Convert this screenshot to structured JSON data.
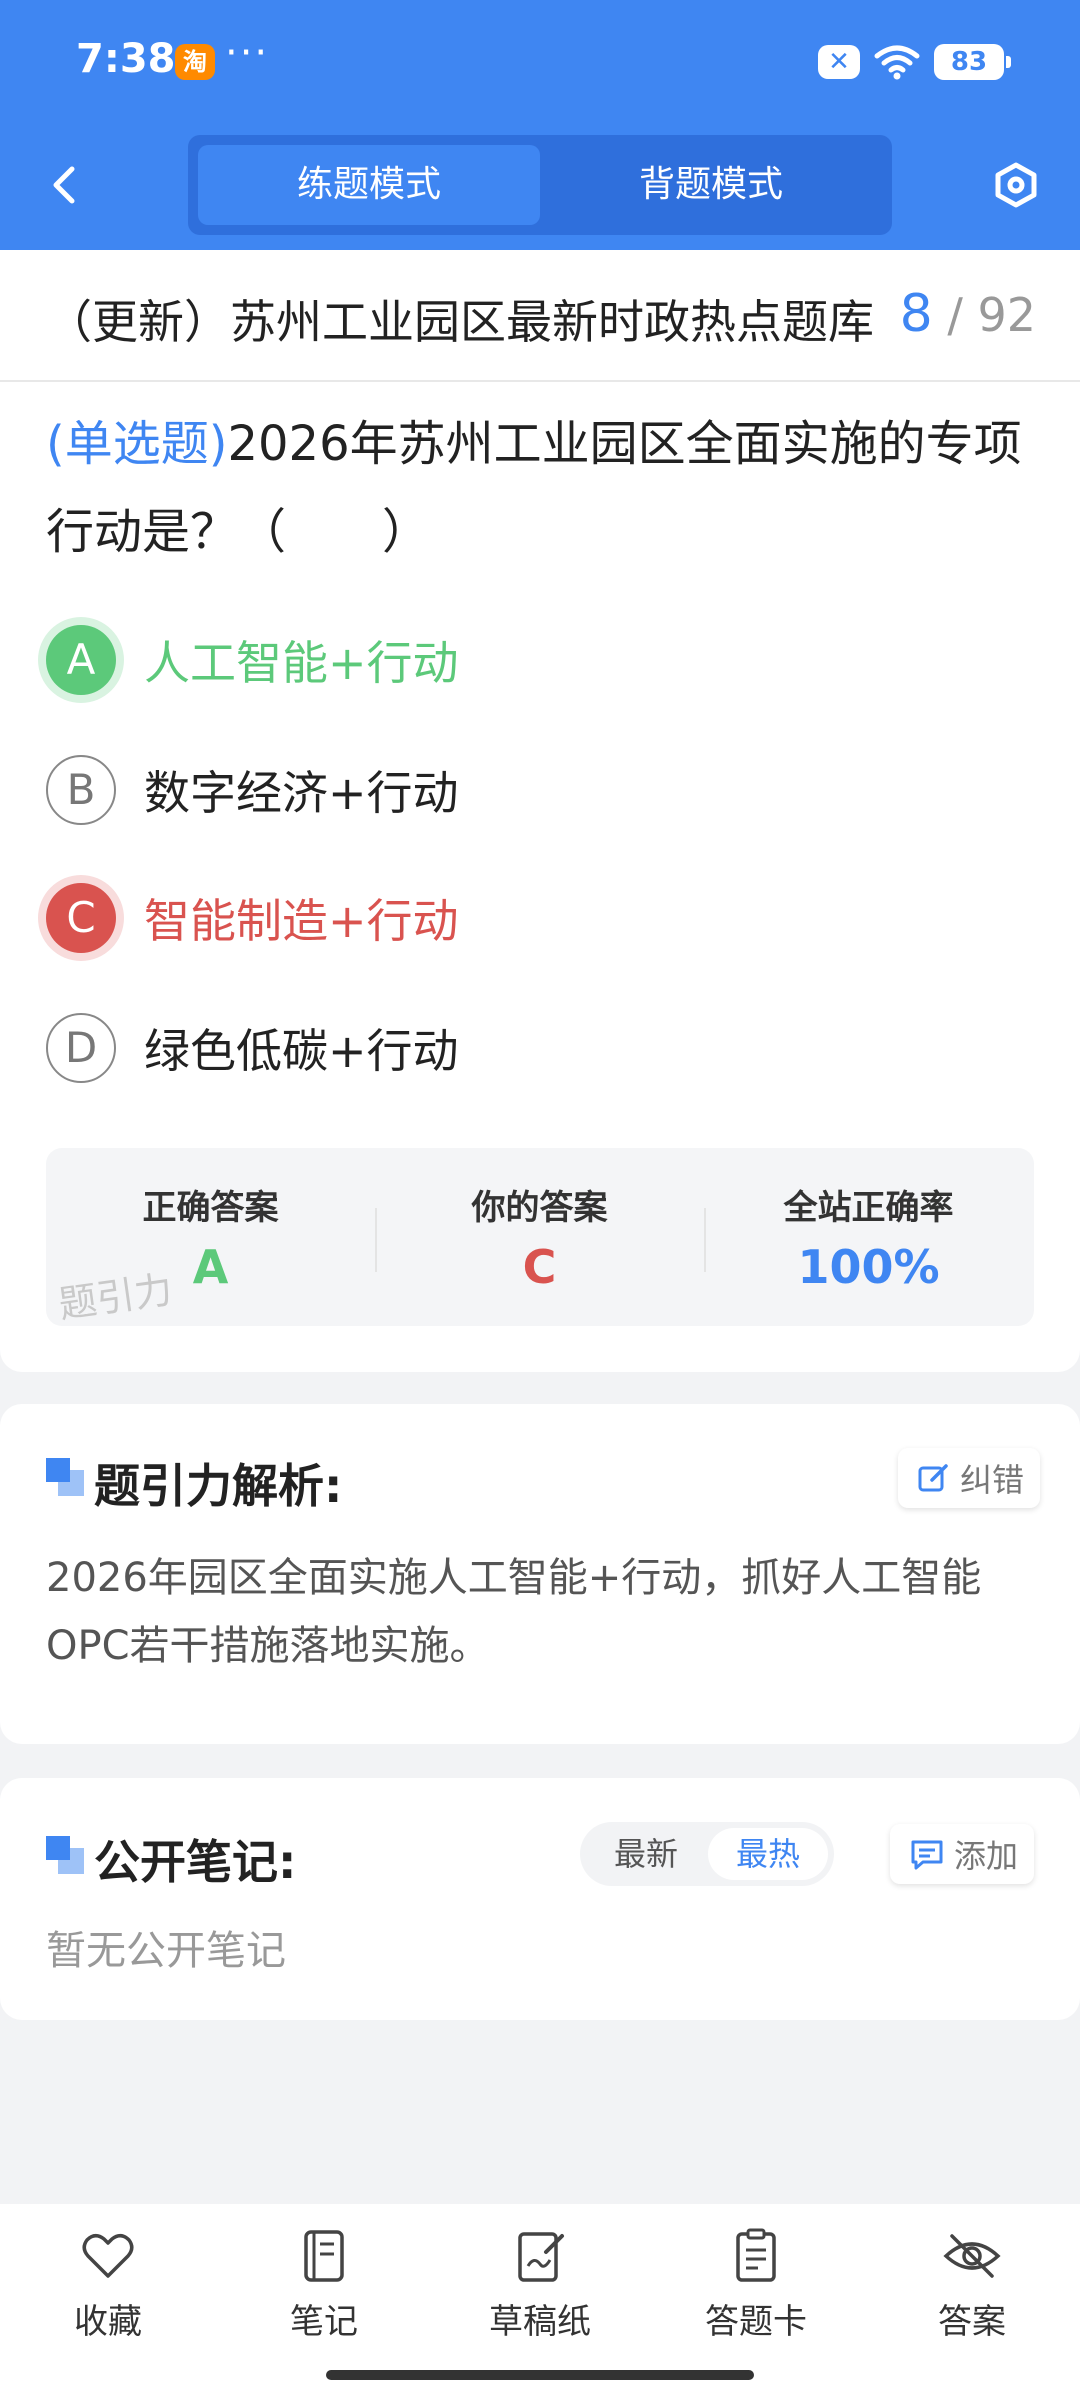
{
  "status_bar": {
    "time": "7:38",
    "app_icon": "淘",
    "more": "···",
    "battery": "83",
    "x_badge": "✕"
  },
  "header": {
    "tabs": [
      {
        "label": "练题模式"
      },
      {
        "label": "背题模式"
      }
    ]
  },
  "question_bank": {
    "title": "（更新）苏州工业园区最新时政热点题库",
    "current": "8",
    "total": "/ 92"
  },
  "question": {
    "type": "(单选题)",
    "text": "2026年苏州工业园区全面实施的专项行动是？（　　）"
  },
  "options": [
    {
      "letter": "A",
      "text": "人工智能+行动",
      "state": "correct"
    },
    {
      "letter": "B",
      "text": "数字经济+行动",
      "state": "normal"
    },
    {
      "letter": "C",
      "text": "智能制造+行动",
      "state": "wrong"
    },
    {
      "letter": "D",
      "text": "绿色低碳+行动",
      "state": "normal"
    }
  ],
  "answer_summary": {
    "correct_label": "正确答案",
    "correct_value": "A",
    "your_label": "你的答案",
    "your_value": "C",
    "rate_label": "全站正确率",
    "rate_value": "100%",
    "watermark": "题引力"
  },
  "analysis": {
    "title": "题引力解析:",
    "report_label": "纠错",
    "text": "2026年园区全面实施人工智能+行动，抓好人工智能OPC若干措施落地实施。"
  },
  "notes": {
    "title": "公开笔记:",
    "sort_options": [
      "最新",
      "最热"
    ],
    "selected_sort": "最热",
    "add_label": "添加",
    "empty_text": "暂无公开笔记"
  },
  "bottom_nav": [
    {
      "label": "收藏",
      "icon": "heart-icon"
    },
    {
      "label": "笔记",
      "icon": "notebook-icon"
    },
    {
      "label": "草稿纸",
      "icon": "draft-paper-icon"
    },
    {
      "label": "答题卡",
      "icon": "answer-card-icon"
    },
    {
      "label": "答案",
      "icon": "eye-off-icon"
    }
  ],
  "colors": {
    "primary": "#3f86f2",
    "correct": "#5cc97a",
    "wrong": "#d9534f"
  }
}
